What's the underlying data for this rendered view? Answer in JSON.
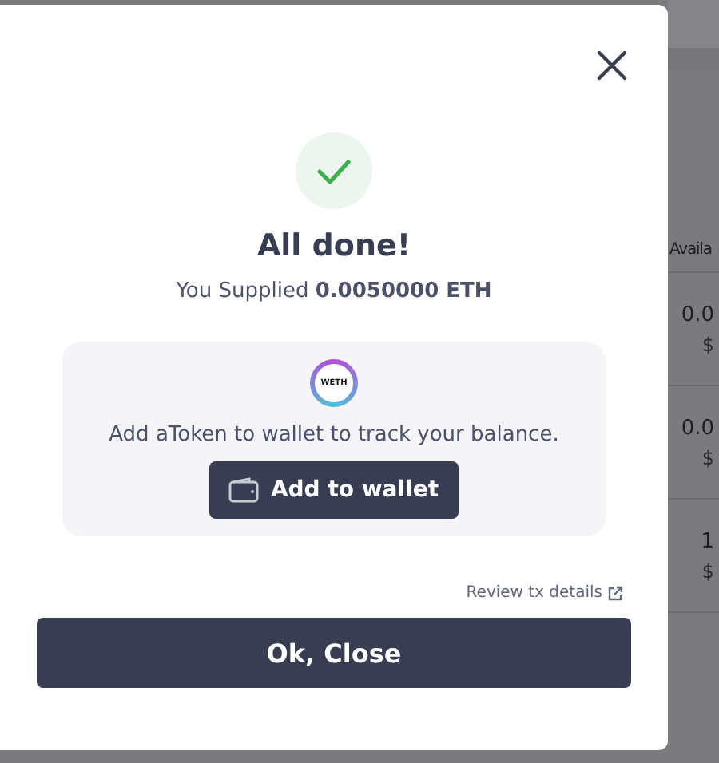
{
  "background_table": {
    "header": "Availa",
    "rows": [
      {
        "amount": "0.0",
        "usd": "$"
      },
      {
        "amount": "0.0",
        "usd": "$"
      },
      {
        "amount": "1",
        "usd": "$"
      }
    ]
  },
  "modal": {
    "title": "All done!",
    "subtitle": "You Supplied **0.0050000 ETH**",
    "token_card": {
      "token_symbol": "WETH",
      "message": "Add aToken to wallet to track your balance.",
      "button": "Add to wallet"
    },
    "review_link": "Review tx details",
    "primary_button": "Ok, Close"
  }
}
